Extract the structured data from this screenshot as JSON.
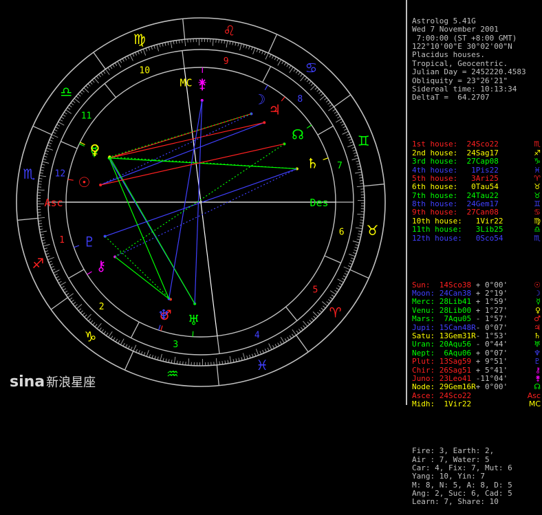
{
  "header": [
    "Astrolog 5.41G",
    "Wed 7 November 2001",
    " 7:00:00 (ST +8:00 GMT)",
    "122°10'00\"E 30°02'00\"N",
    "Placidus houses.",
    "Tropical, Geocentric.",
    "Julian Day = 2452220.4583",
    "Obliquity = 23°26'21\"",
    "Sidereal time: 10:13:34",
    "DeltaT =  64.2707"
  ],
  "houses": [
    {
      "text": "1st house:  24Sco22",
      "color": "#ff2020",
      "glyph": "♏"
    },
    {
      "text": "2nd house:  24Sag17",
      "color": "#ffff00",
      "glyph": "♐"
    },
    {
      "text": "3rd house:  27Cap08",
      "color": "#00ff00",
      "glyph": "♑"
    },
    {
      "text": "4th house:   1Pis22",
      "color": "#4040ff",
      "glyph": "♓"
    },
    {
      "text": "5th house:   3Ari25",
      "color": "#ff2020",
      "glyph": "♈"
    },
    {
      "text": "6th house:   0Tau54",
      "color": "#ffff00",
      "glyph": "♉"
    },
    {
      "text": "7th house:  24Tau22",
      "color": "#00ff00",
      "glyph": "♉"
    },
    {
      "text": "8th house:  24Gem17",
      "color": "#4040ff",
      "glyph": "♊"
    },
    {
      "text": "9th house:  27Can08",
      "color": "#ff2020",
      "glyph": "♋"
    },
    {
      "text": "10th house:   1Vir22",
      "color": "#ffff00",
      "glyph": "♍"
    },
    {
      "text": "11th house:   3Lib25",
      "color": "#00ff00",
      "glyph": "♎"
    },
    {
      "text": "12th house:   0Sco54",
      "color": "#4040ff",
      "glyph": "♏"
    }
  ],
  "planets": [
    {
      "name": "Sun:",
      "pos": " 14Sco38",
      "pcolor": "#ff2020",
      "speed": " + 0°00'",
      "glyph": "☉",
      "gcolor": "#ff2020"
    },
    {
      "name": "Moon:",
      "pos": " 24Can38",
      "pcolor": "#4040ff",
      "speed": " + 2°19'",
      "glyph": "☽",
      "gcolor": "#4040ff"
    },
    {
      "name": "Merc:",
      "pos": " 28Lib41",
      "pcolor": "#00ff00",
      "speed": " + 1°59'",
      "glyph": "☿",
      "gcolor": "#00ff00"
    },
    {
      "name": "Venu:",
      "pos": " 28Lib00",
      "pcolor": "#00ff00",
      "speed": " + 1°27'",
      "glyph": "♀",
      "gcolor": "#ffff00"
    },
    {
      "name": "Mars:",
      "pos": "  7Aqu05",
      "pcolor": "#00ff00",
      "speed": " - 1°57'",
      "glyph": "♂",
      "gcolor": "#ff2020"
    },
    {
      "name": "Jupi:",
      "pos": " 15Can48R",
      "pcolor": "#4040ff",
      "speed": "- 0°07'",
      "glyph": "♃",
      "gcolor": "#ff2020"
    },
    {
      "name": "Satu:",
      "pos": " 13Gem31R",
      "pcolor": "#ffff00",
      "speed": "- 1°53'",
      "glyph": "♄",
      "gcolor": "#ffff00"
    },
    {
      "name": "Uran:",
      "pos": " 20Aqu56",
      "pcolor": "#00ff00",
      "speed": " - 0°44'",
      "glyph": "♅",
      "gcolor": "#00ff00"
    },
    {
      "name": "Nept:",
      "pos": "  6Aqu06",
      "pcolor": "#00ff00",
      "speed": " + 0°07'",
      "glyph": "♆",
      "gcolor": "#4040ff"
    },
    {
      "name": "Plut:",
      "pos": " 13Sag59",
      "pcolor": "#ff2020",
      "speed": " + 9°51'",
      "glyph": "♇",
      "gcolor": "#4040ff"
    },
    {
      "name": "Chir:",
      "pos": " 26Sag51",
      "pcolor": "#ff2020",
      "speed": " + 5°41'",
      "glyph": "⚷",
      "gcolor": "#ff00ff"
    },
    {
      "name": "Juno:",
      "pos": " 23Leo41",
      "pcolor": "#ff2020",
      "speed": " -11°04'",
      "glyph": "⚵",
      "gcolor": "#ff00ff"
    },
    {
      "name": "Node:",
      "pos": " 29Gem16R",
      "pcolor": "#ffff00",
      "speed": "+ 0°00'",
      "glyph": "☊",
      "gcolor": "#00ff00"
    },
    {
      "name": "Asce:",
      "pos": " 24Sco22",
      "pcolor": "#ff2020",
      "speed": "",
      "glyph": "Asc",
      "gcolor": "#ff2020"
    },
    {
      "name": "Midh:",
      "pos": "  1Vir22",
      "pcolor": "#ffff00",
      "speed": "",
      "glyph": "MC",
      "gcolor": "#ffff00"
    }
  ],
  "summary": [
    "Fire: 3, Earth: 2,",
    "Air : 7, Water: 5",
    "Car: 4, Fix: 7, Mut: 6",
    "Yang: 10, Yin: 7",
    "M: 8, N: 5, A: 8, D: 5",
    "Ang: 2, Suc: 6, Cad: 5",
    "Learn: 7, Share: 10"
  ],
  "wheel": {
    "sign_glyphs": [
      "♈",
      "♉",
      "♊",
      "♋",
      "♌",
      "♍",
      "♎",
      "♏",
      "♐",
      "♑",
      "♒",
      "♓"
    ],
    "sign_colors": [
      "#ff2020",
      "#ffff00",
      "#00ff00",
      "#4040ff",
      "#ff2020",
      "#ffff00",
      "#00ff00",
      "#4040ff",
      "#ff2020",
      "#ffff00",
      "#00ff00",
      "#4040ff"
    ],
    "house_numbers": [
      "1",
      "2",
      "3",
      "4",
      "5",
      "6",
      "7",
      "8",
      "9",
      "10",
      "11",
      "12"
    ],
    "house_colors": [
      "#ff2020",
      "#ffff00",
      "#00ff00",
      "#4040ff",
      "#ff2020",
      "#ffff00",
      "#00ff00",
      "#4040ff",
      "#ff2020",
      "#ffff00",
      "#00ff00",
      "#4040ff"
    ],
    "asc_label": "Asc",
    "des_label": "Des",
    "mc_label": "MC",
    "ic_label": "IC"
  },
  "watermark": {
    "brand": "sina",
    "text": "新浪星座"
  }
}
